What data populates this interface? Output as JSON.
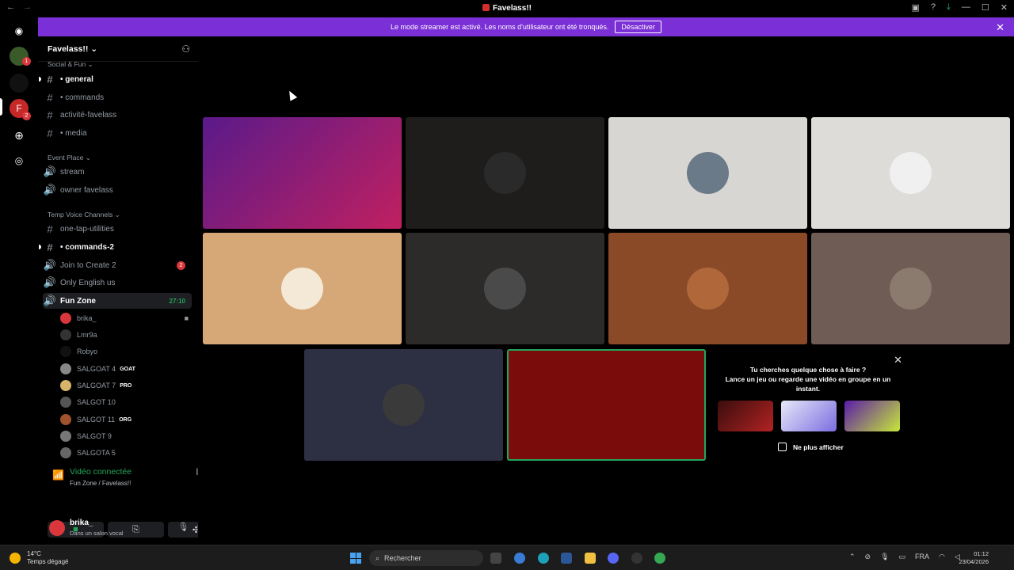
{
  "window": {
    "title": "Favelass!!"
  },
  "banner": {
    "text": "Le mode streamer est activé. Les noms d'utilisateur ont été tronqués.",
    "button": "Désactiver"
  },
  "rail": {
    "badge1": "1",
    "badge2": "2"
  },
  "server": {
    "name": "Favelass!! ⌄"
  },
  "categories": {
    "social": "Social & Fun ⌄",
    "event": "Event Place ⌄",
    "temp": "Temp Voice Channels ⌄"
  },
  "channels": {
    "general": "• general",
    "commands": "• commands",
    "activite": "activité-favelass",
    "media": "• media",
    "stream": "stream",
    "owner": "owner favelass",
    "onetap": "one-tap-utilities",
    "commands2": "• commands-2",
    "join": "Join to Create 2",
    "join_count": "2",
    "english": "Only English us",
    "funzone": "Fun Zone",
    "funzone_time": "27:10"
  },
  "voice_users": [
    {
      "name": "brika_",
      "tag": "",
      "color": "#da373c"
    },
    {
      "name": "Lmr9a",
      "tag": "",
      "color": "#333"
    },
    {
      "name": "Robyo",
      "tag": "",
      "color": "#111"
    },
    {
      "name": "SALGOAT 4",
      "tag": "GOAT",
      "color": "#888"
    },
    {
      "name": "SALGOAT 7",
      "tag": "PRO",
      "color": "#d8b46a"
    },
    {
      "name": "SALGOT 10",
      "tag": "",
      "color": "#555"
    },
    {
      "name": "SALGOT 11",
      "tag": "ORG",
      "color": "#a0522d"
    },
    {
      "name": "SALGOT 9",
      "tag": "",
      "color": "#777"
    },
    {
      "name": "SALGOTA 5",
      "tag": "",
      "color": "#666"
    }
  ],
  "connection": {
    "status": "Vidéo connectée",
    "location": "Fun Zone / Favelass!!"
  },
  "user": {
    "name": "brika_",
    "status": "Dans un salon vocal"
  },
  "activity": {
    "line1": "Tu cherches quelque chose à faire ?",
    "line2": "Lance un jeu ou regarde une vidéo en groupe en un instant.",
    "checkbox": "Ne plus afficher"
  },
  "taskbar": {
    "temp": "14°C",
    "weather": "Temps dégagé",
    "search": "Rechercher",
    "lang": "FRA",
    "time": "01:12",
    "date": "23/04/2026"
  },
  "colors": {
    "accent": "#7b2fd6",
    "green": "#23a55a",
    "red": "#da373c"
  }
}
